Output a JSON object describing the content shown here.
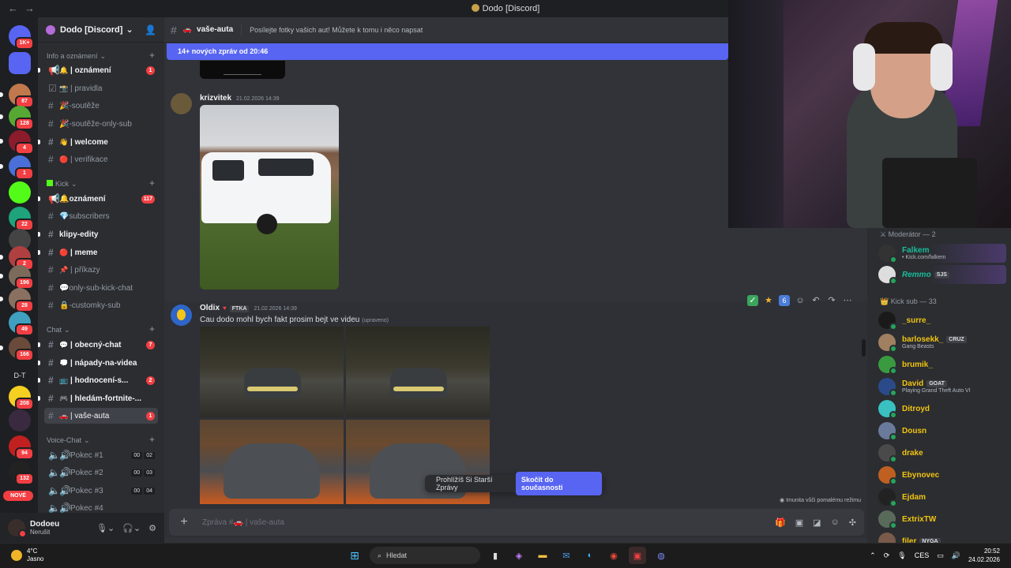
{
  "window": {
    "title": "Dodo [Discord]",
    "back": "←",
    "forward": "→"
  },
  "servers": [
    {
      "badge": "1K+",
      "color": "#5865f2"
    },
    {
      "badge": "",
      "color": "#5865f2"
    },
    {
      "badge": "87",
      "color": "#c0784c"
    },
    {
      "badge": "128",
      "color": "#56a832"
    },
    {
      "badge": "4",
      "color": "#8a1c2c"
    },
    {
      "badge": "1",
      "color": "#4a6fd8"
    },
    {
      "badge": "",
      "color": "#53fc18"
    },
    {
      "badge": "22",
      "color": "#1ea37a"
    },
    {
      "badge": "",
      "color": "#444"
    },
    {
      "badge": "2",
      "color": "#b04040"
    },
    {
      "badge": "196",
      "color": "#7c6a5a"
    },
    {
      "badge": "28",
      "color": "#8a7060"
    },
    {
      "badge": "49",
      "color": "#3fa0c0"
    },
    {
      "badge": "166",
      "color": "#6a4a3a"
    },
    {
      "badge": "",
      "color": "#2b2d31",
      "label": "D-T"
    },
    {
      "badge": "208",
      "color": "#f5d020"
    },
    {
      "badge": "",
      "color": "#3a2a40"
    },
    {
      "badge": "94",
      "color": "#c02020"
    },
    {
      "badge": "132",
      "color": "#222"
    }
  ],
  "new_label": "NOVÉ",
  "guild": {
    "name": "Dodo [Discord]",
    "chevron": "⌄"
  },
  "categories": {
    "info": "Info a oznámení",
    "kick": "Kick",
    "chat": "Chat",
    "voice": "Voice-Chat"
  },
  "channels": {
    "ch1": {
      "emoji": "🔔",
      "name": "| oznámení",
      "badge": "1"
    },
    "ch2": {
      "emoji": "📸",
      "name": "| pravidla"
    },
    "ch3": {
      "emoji": "",
      "name": "🎉-soutěže"
    },
    "ch4": {
      "emoji": "",
      "name": "🎉-soutěže-only-sub"
    },
    "ch5": {
      "emoji": "👋",
      "name": "| welcome"
    },
    "ch6": {
      "emoji": "🔴",
      "name": "| verifikace"
    },
    "ch7": {
      "emoji": "",
      "name": "🔔oznámení",
      "badge": "117"
    },
    "ch8": {
      "emoji": "",
      "name": "💎subscribers"
    },
    "ch9": {
      "emoji": "",
      "name": "klipy-edity"
    },
    "ch10": {
      "emoji": "🔴",
      "name": "| meme"
    },
    "ch11": {
      "emoji": "📌",
      "name": "| příkazy"
    },
    "ch12": {
      "emoji": "",
      "name": "💬only-sub-kick-chat"
    },
    "ch13": {
      "emoji": "",
      "name": "🔒-customky-sub"
    },
    "ch14": {
      "emoji": "💬",
      "name": "| obecný-chat",
      "badge": "7"
    },
    "ch15": {
      "emoji": "💭",
      "name": "| nápady-na-videa"
    },
    "ch16": {
      "emoji": "📺",
      "name": "| hodnocení-s...",
      "badge": "2"
    },
    "ch17": {
      "emoji": "🎮",
      "name": "| hledám-fortnite-..."
    },
    "ch18": {
      "emoji": "🚗",
      "name": "| vaše-auta",
      "badge": "1"
    }
  },
  "voice_channels": [
    {
      "name": "Pokec #1",
      "a": "00",
      "b": "02"
    },
    {
      "name": "Pokec #2",
      "a": "00",
      "b": "03"
    },
    {
      "name": "Pokec #3",
      "a": "00",
      "b": "04"
    },
    {
      "name": "Pokec #4",
      "a": "",
      "b": ""
    }
  ],
  "user": {
    "name": "Dodoeu",
    "status": "Nerušit"
  },
  "header": {
    "channel": "vaše-auta",
    "topic": "Posílejte fotky vašich aut! Můžete k tomu i něco napsat"
  },
  "new_messages_bar": "14+ nových zpráv od 20:46",
  "messages": {
    "m1": {
      "author": "krizvitek",
      "time": "21.02.2026 14:39"
    },
    "m2": {
      "author": "Oldix",
      "tag": "FTKA",
      "time": "21.02.2026 14:39",
      "text": "Cau dodo mohl bych fakt prosim bejt ve videu",
      "edited": "(upraveno)"
    }
  },
  "reaction_bar": {
    "count": "6"
  },
  "older_bar": {
    "text": "Prohlížíš Si Starší Zprávy",
    "jump": "Skočit do současnosti"
  },
  "slowmode": "Imunita vůči pomalému režimu",
  "composer": {
    "placeholder": "Zpráva #🚗 | vaše-auta"
  },
  "members": {
    "mod_header": "Moderátor — 2",
    "mods": [
      {
        "name": "Falkem",
        "sub": "• Kick.com/falkem",
        "color": "#1abc9c",
        "tag": ""
      },
      {
        "name": "Remmo",
        "sub": "",
        "color": "#1abc9c",
        "tag": "SJS"
      }
    ],
    "sub_header": "Kick sub — 33",
    "subs": [
      {
        "name": "_surre_",
        "sub": "",
        "tag": ""
      },
      {
        "name": "barlosekk_",
        "sub": "Gang Beasts",
        "tag": "CRUZ"
      },
      {
        "name": "brumik_",
        "sub": "",
        "tag": ""
      },
      {
        "name": "David",
        "sub": "Playing Grand Theft Auto VI",
        "tag": "GOAT"
      },
      {
        "name": "Ditroyd",
        "sub": "",
        "tag": ""
      },
      {
        "name": "Dousn",
        "sub": "",
        "tag": ""
      },
      {
        "name": "drake",
        "sub": "",
        "tag": ""
      },
      {
        "name": "Ebynovec",
        "sub": "",
        "tag": ""
      },
      {
        "name": "Ejdam",
        "sub": "",
        "tag": ""
      },
      {
        "name": "ExtrixTW",
        "sub": "",
        "tag": ""
      },
      {
        "name": "filer",
        "sub": "",
        "tag": "NYGA"
      }
    ],
    "sub_color": "#f1c40f"
  },
  "taskbar": {
    "temp": "4°C",
    "weather": "Jasno",
    "search": "Hledat",
    "lang": "CES",
    "time": "20:52",
    "date": "24.02.2026"
  }
}
